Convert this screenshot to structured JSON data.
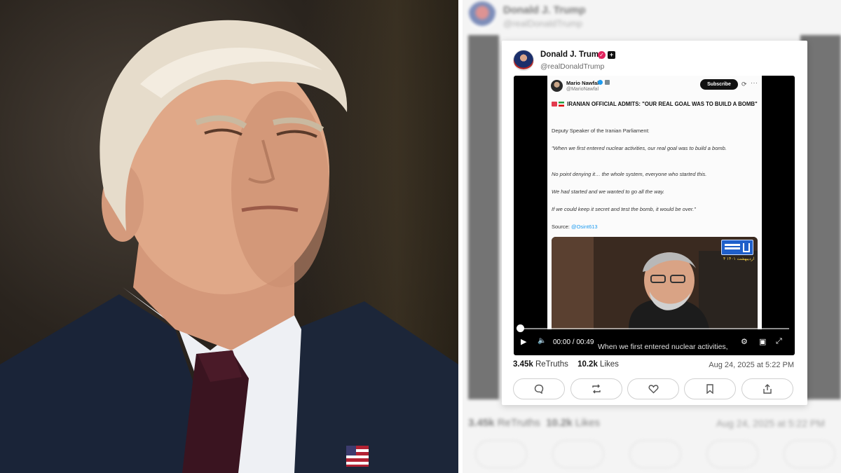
{
  "post": {
    "author_name": "Donald J. Trump",
    "author_handle": "@realDonaldTrump",
    "stats": {
      "retruths_count": "3.45k",
      "retruths_label": "ReTruths",
      "likes_count": "10.2k",
      "likes_label": "Likes"
    },
    "date": "Aug 24, 2025 at 5:22 PM",
    "actions": [
      "reply-icon",
      "retruth-icon",
      "like-icon",
      "bookmark-icon",
      "share-icon"
    ]
  },
  "embedded": {
    "author_name": "Mario Nawfal",
    "author_handle": "@MarioNawfal",
    "subscribe_label": "Subscribe",
    "headline": "IRANIAN OFFICIAL ADMITS: \"OUR REAL GOAL WAS TO BUILD A BOMB\"",
    "lines": [
      "Deputy Speaker of the Iranian Parliament:",
      "\"When we first entered nuclear activities, our real goal was to build a bomb.",
      "No point denying it… the whole system, everyone who started this.",
      "We had started and we wanted to go all the way.",
      "If we could keep it secret and test the bomb, it would be over.\""
    ],
    "source_label": "Source:",
    "source_link": "@Osint613",
    "logo_date": "۴ اردیبهشت ۱۴۰۱"
  },
  "video": {
    "time_display": "00:00 / 00:49",
    "caption": "When we first entered nuclear activities,",
    "progress": 0
  },
  "background": {
    "author_name": "Donald J. Trump",
    "author_handle": "@realDonaldTrump",
    "retruths_count": "3.45k",
    "retruths_label": "ReTruths",
    "likes_count": "10.2k",
    "likes_label": "Likes",
    "date": "Aug 24, 2025 at 5:22 PM"
  },
  "colors": {
    "link": "#1d9bf0",
    "badge": "#e0245e",
    "video_bg": "#000000"
  }
}
